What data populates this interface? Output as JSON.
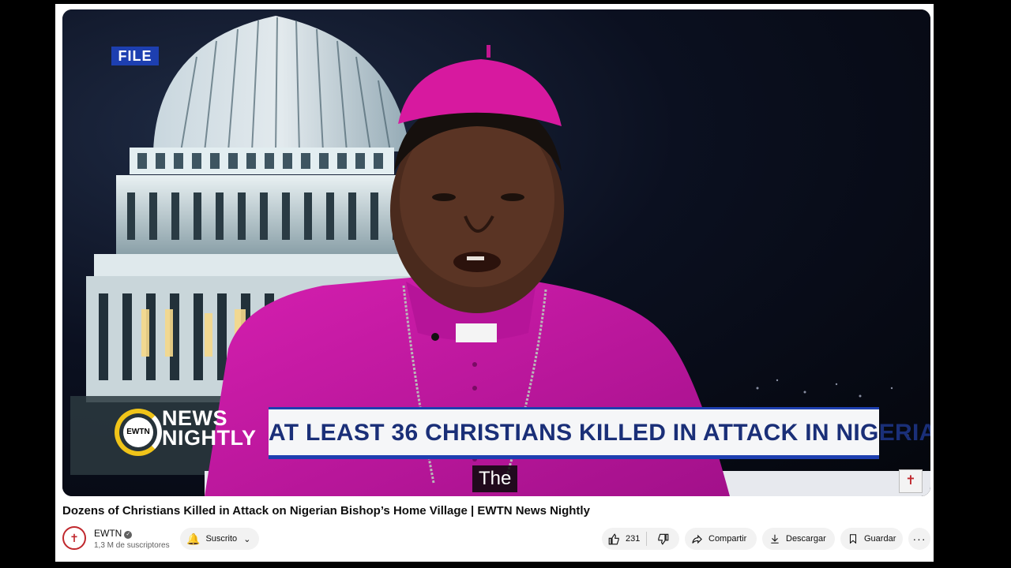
{
  "video": {
    "file_badge": "FILE",
    "logo_top": "NEWS",
    "logo_bottom": "NIGHTLY",
    "logo_mark": "EWTN",
    "headline": "AT LEAST 36 CHRISTIANS KILLED IN ATTACK IN NIGERIA",
    "caption": "The",
    "colors": {
      "accent_blue": "#1d3fb0",
      "headline_text": "#1a2f78",
      "logo_yellow": "#f0c419",
      "vestment_magenta": "#c0169f"
    }
  },
  "meta": {
    "title": "Dozens of Christians Killed in Attack on Nigerian Bishop’s Home Village | EWTN News Nightly",
    "channel_name": "EWTN",
    "subscribers": "1,3 M de suscriptores",
    "subscribed_label": "Suscrito",
    "likes": "231",
    "share_label": "Compartir",
    "download_label": "Descargar",
    "save_label": "Guardar",
    "more_label": "···",
    "icons": [
      "bell-icon",
      "chevron-down-icon",
      "thumbs-up-icon",
      "thumbs-down-icon",
      "share-icon",
      "download-icon",
      "bookmark-icon",
      "more-icon",
      "verified-icon"
    ]
  }
}
